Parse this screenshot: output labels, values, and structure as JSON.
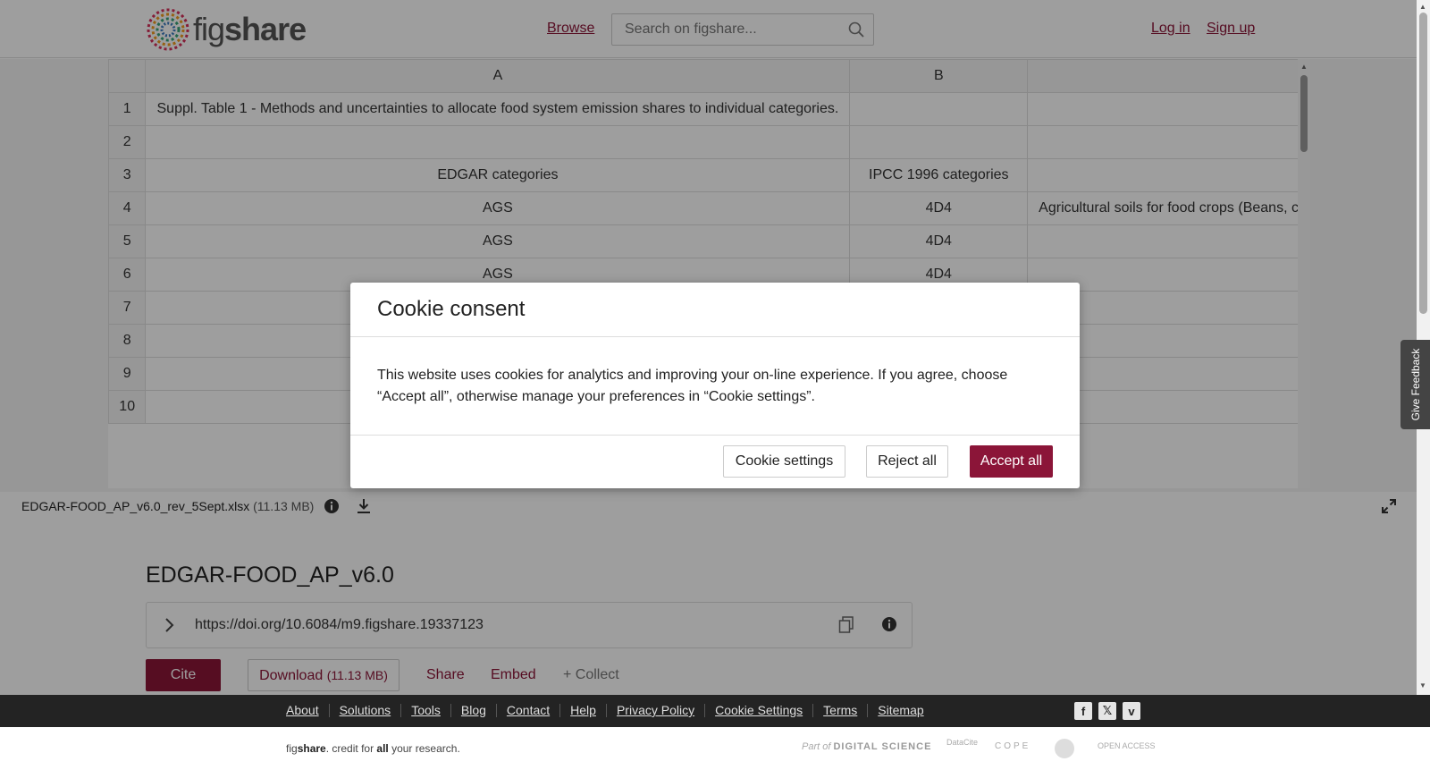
{
  "header": {
    "logo_light": "fig",
    "logo_bold": "share",
    "browse": "Browse",
    "search_placeholder": "Search on figshare...",
    "login": "Log in",
    "signup": "Sign up"
  },
  "spreadsheet": {
    "columns": [
      "",
      "A",
      "B",
      ""
    ],
    "rows": [
      {
        "num": "1",
        "a": "Suppl. Table 1 - Methods and uncertainties to allocate food system emission shares to individual categories.",
        "b": "",
        "c": ""
      },
      {
        "num": "2",
        "a": "",
        "b": "",
        "c": ""
      },
      {
        "num": "3",
        "a": "EDGAR categories",
        "b": "IPCC 1996 categories",
        "c": ""
      },
      {
        "num": "4",
        "a": "AGS",
        "b": "4D4",
        "c": "Agricultural soils for food crops (Beans, c"
      },
      {
        "num": "5",
        "a": "AGS",
        "b": "4D4",
        "c": ""
      },
      {
        "num": "6",
        "a": "AGS",
        "b": "4D4",
        "c": ""
      },
      {
        "num": "7",
        "a": "",
        "b": "",
        "c": ""
      },
      {
        "num": "8",
        "a": "",
        "b": "",
        "c": ""
      },
      {
        "num": "9",
        "a": "",
        "b": "",
        "c": ""
      },
      {
        "num": "10",
        "a": "",
        "b": "",
        "c": ""
      }
    ]
  },
  "file": {
    "name": "EDGAR-FOOD_AP_v6.0_rev_5Sept.xlsx",
    "size": "(11.13 MB)"
  },
  "item": {
    "title": "EDGAR-FOOD_AP_v6.0",
    "doi": "https://doi.org/10.6084/m9.figshare.19337123",
    "cite": "Cite",
    "download": "Download",
    "download_size": "(11.13 MB)",
    "share": "Share",
    "embed": "Embed",
    "collect": "+ Collect"
  },
  "feedback": "Give Feedback",
  "modal": {
    "title": "Cookie consent",
    "body": "This website uses cookies for analytics and improving your on-line experience. If you agree, choose “Accept all”, otherwise manage your preferences in “Cookie settings”.",
    "settings": "Cookie settings",
    "reject": "Reject all",
    "accept": "Accept all"
  },
  "footer": {
    "links": [
      "About",
      "Solutions",
      "Tools",
      "Blog",
      "Contact",
      "Help",
      "Privacy Policy",
      "Cookie Settings",
      "Terms",
      "Sitemap"
    ],
    "tagline_pre": "fig",
    "tagline_bold": "share",
    "tagline_mid": ". credit for ",
    "tagline_all": "all",
    "tagline_end": " your research.",
    "partners": {
      "ds_part": "Part of",
      "ds_name": "DIGITAL SCIENCE",
      "datacite": "DataCite",
      "cope": "COPE",
      "oa": "OPEN ACCESS"
    }
  },
  "colors": {
    "brand": "#8b1538",
    "footer_bg": "#232323"
  }
}
